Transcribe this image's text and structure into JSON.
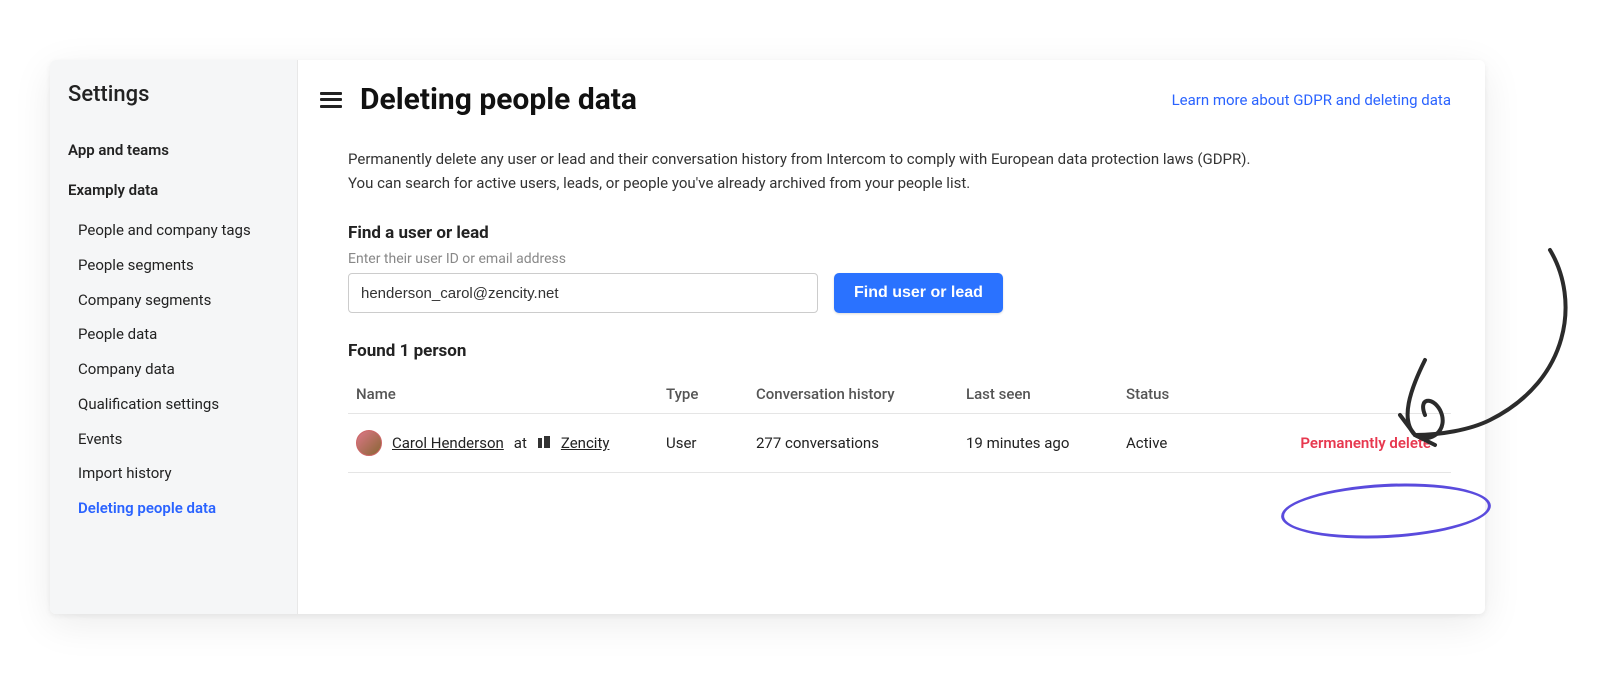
{
  "sidebar": {
    "title": "Settings",
    "top_items": [
      {
        "label": "App and teams"
      },
      {
        "label": "Examply data",
        "active_section": true
      }
    ],
    "sub_items": [
      {
        "label": "People and company tags"
      },
      {
        "label": "People segments"
      },
      {
        "label": "Company segments"
      },
      {
        "label": "People data"
      },
      {
        "label": "Company data"
      },
      {
        "label": "Qualification settings"
      },
      {
        "label": "Events"
      },
      {
        "label": "Import history"
      },
      {
        "label": "Deleting people data",
        "active": true
      }
    ]
  },
  "header": {
    "title": "Deleting people data",
    "learn_more": "Learn more about GDPR and deleting data"
  },
  "description_line1": "Permanently delete any user or lead and their conversation history from Intercom to comply with European data protection laws (GDPR).",
  "description_line2": "You can search for active users, leads, or people you've already archived from your people list.",
  "search": {
    "section_title": "Find a user or lead",
    "label": "Enter their user ID or email address",
    "value": "henderson_carol@zencity.net",
    "button": "Find user or lead"
  },
  "results": {
    "title": "Found 1 person",
    "columns": {
      "name": "Name",
      "type": "Type",
      "history": "Conversation history",
      "last_seen": "Last seen",
      "status": "Status"
    },
    "row": {
      "person_name": "Carol Henderson",
      "at": "at",
      "company": "Zencity",
      "type": "User",
      "history": "277 conversations",
      "last_seen": "19 minutes ago",
      "status": "Active",
      "action": "Permanently delete"
    }
  }
}
